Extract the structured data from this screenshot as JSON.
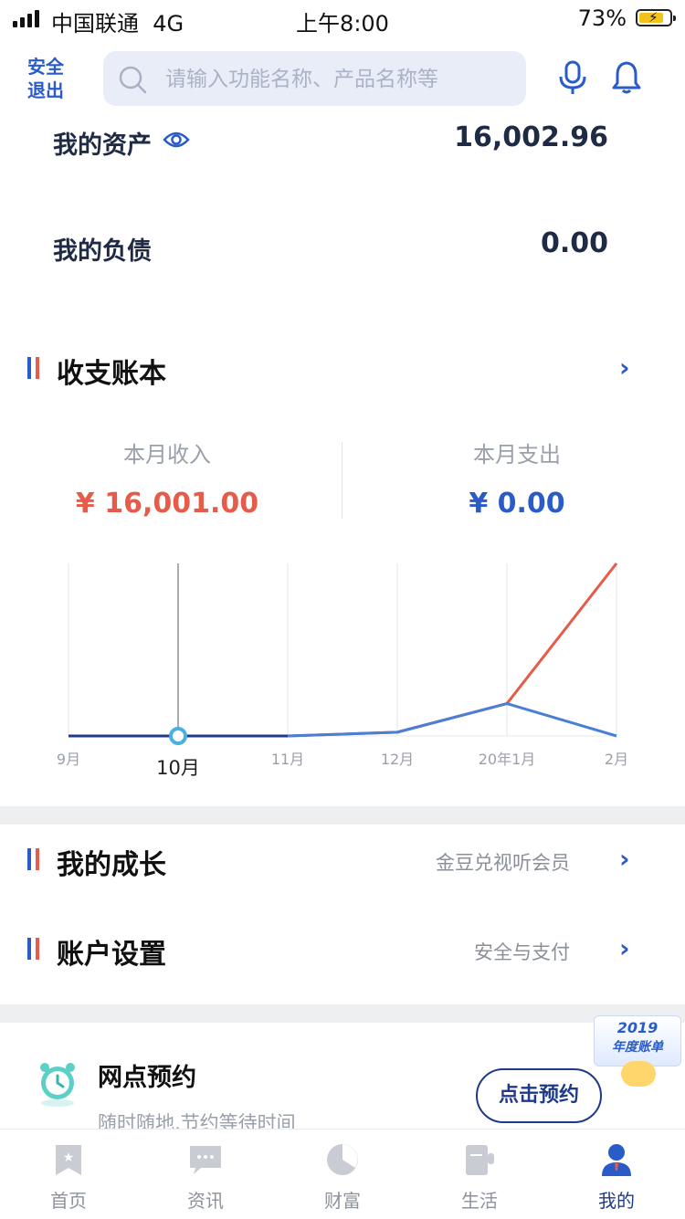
{
  "status_bar": {
    "carrier": "中国联通",
    "network": "4G",
    "time": "上午8:00",
    "battery": "73%"
  },
  "header": {
    "logout_label": "安全退出",
    "search_placeholder": "请输入功能名称、产品名称等"
  },
  "assets": {
    "label": "我的资产",
    "value": "16,002.96"
  },
  "liabilities": {
    "label": "我的负债",
    "value": "0.00"
  },
  "ledger": {
    "title": "收支账本",
    "income_label": "本月收入",
    "income_value": "¥ 16,001.00",
    "expense_label": "本月支出",
    "expense_value": "¥ 0.00"
  },
  "chart_data": {
    "type": "line",
    "categories": [
      "9月",
      "10月",
      "11月",
      "12月",
      "20年1月",
      "2月"
    ],
    "selected_category": "10月",
    "series": [
      {
        "values": [
          0,
          0,
          0,
          350,
          3000,
          16001
        ],
        "color": "#e65b4a"
      },
      {
        "values": [
          0,
          0,
          0,
          350,
          3000,
          0
        ],
        "color": "#4a7fd6"
      }
    ],
    "grid": true
  },
  "growth": {
    "title": "我的成长",
    "subtitle": "金豆兑视听会员"
  },
  "account": {
    "title": "账户设置",
    "subtitle": "安全与支付"
  },
  "appointment": {
    "title": "网点预约",
    "subtitle": "随时随地,节约等待时间",
    "button": "点击预约"
  },
  "badge": {
    "year": "2019",
    "text": "年度账单"
  },
  "tabs": [
    {
      "label": "首页",
      "icon": "home-bookmark-icon"
    },
    {
      "label": "资讯",
      "icon": "chat-bubble-icon"
    },
    {
      "label": "财富",
      "icon": "pie-chart-icon"
    },
    {
      "label": "生活",
      "icon": "cup-icon"
    },
    {
      "label": "我的",
      "icon": "person-icon",
      "active": true
    }
  ],
  "colors": {
    "accent_blue": "#2a5cc9",
    "navy": "#1f3a8a",
    "income_red": "#e65b4a"
  }
}
